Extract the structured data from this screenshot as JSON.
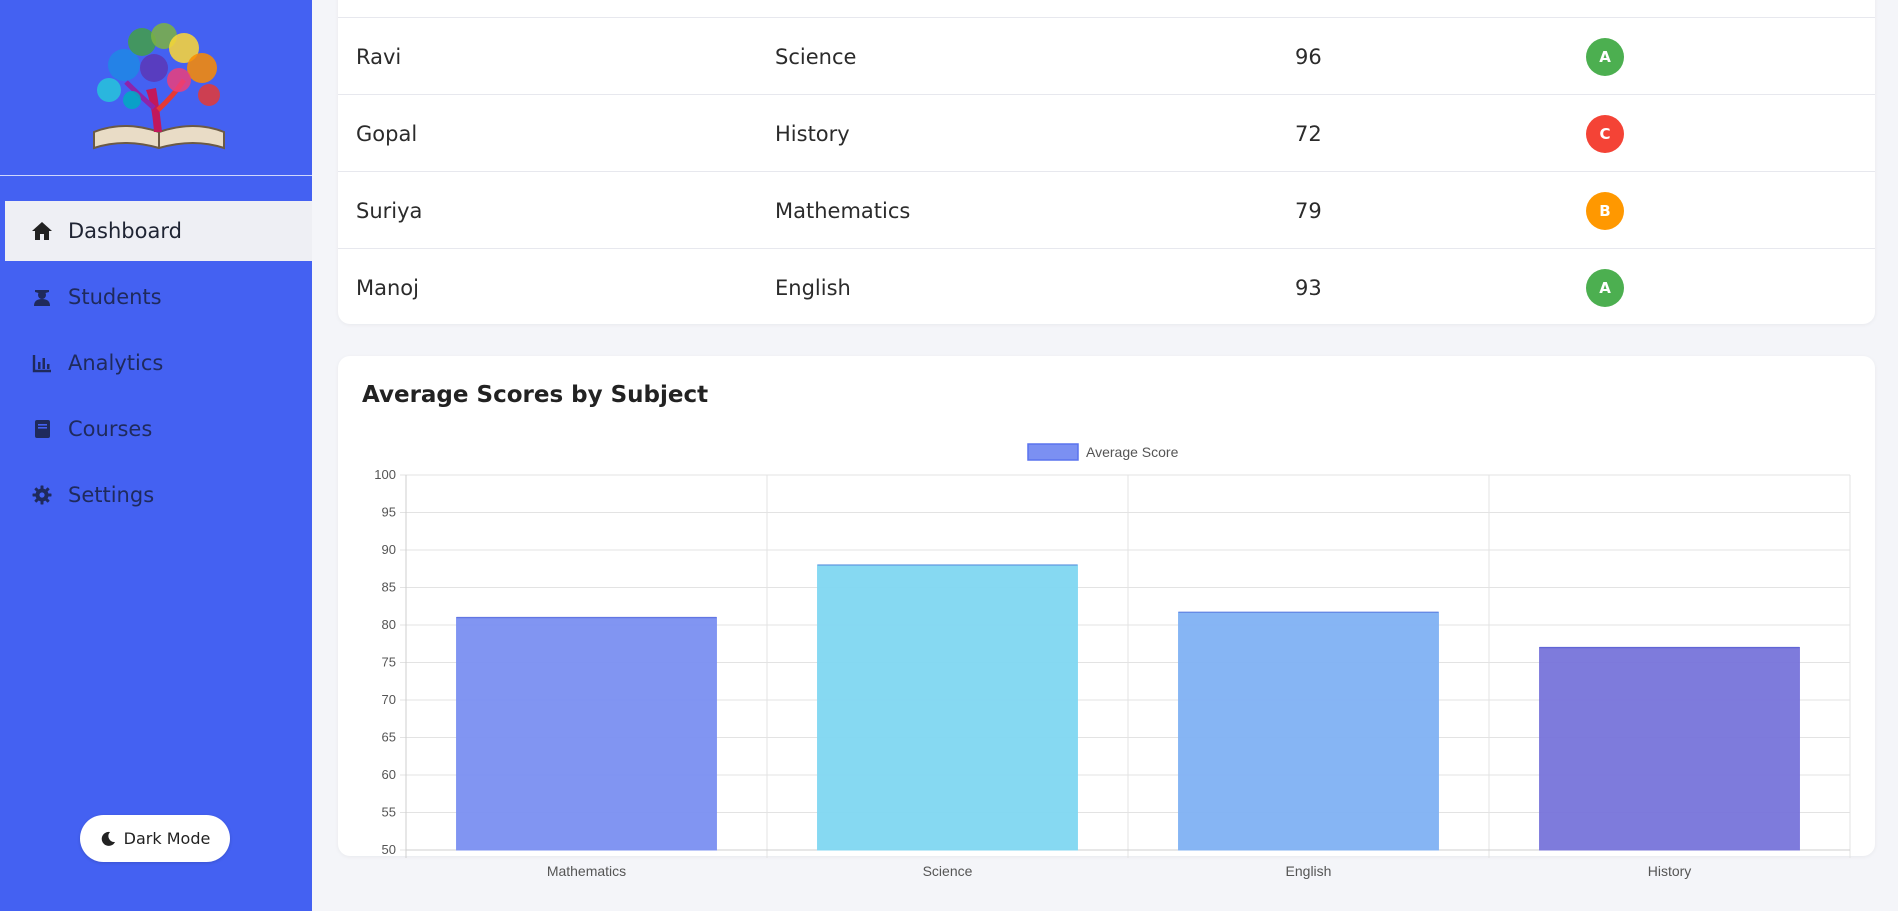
{
  "sidebar": {
    "logo_icon": "tree-book-logo",
    "items": [
      {
        "label": "Dashboard",
        "icon": "home-icon",
        "active": true
      },
      {
        "label": "Students",
        "icon": "student-icon",
        "active": false
      },
      {
        "label": "Analytics",
        "icon": "chart-icon",
        "active": false
      },
      {
        "label": "Courses",
        "icon": "book-icon",
        "active": false
      },
      {
        "label": "Settings",
        "icon": "gear-icon",
        "active": false
      }
    ],
    "dark_mode_label": "Dark Mode",
    "dark_mode_icon": "moon-icon"
  },
  "table": {
    "rows": [
      {
        "name": "Ravi",
        "subject": "Science",
        "score": "96",
        "grade": "A",
        "grade_color": "#4caf50"
      },
      {
        "name": "Gopal",
        "subject": "History",
        "score": "72",
        "grade": "C",
        "grade_color": "#f44336"
      },
      {
        "name": "Suriya",
        "subject": "Mathematics",
        "score": "79",
        "grade": "B",
        "grade_color": "#ff9800"
      },
      {
        "name": "Manoj",
        "subject": "English",
        "score": "93",
        "grade": "A",
        "grade_color": "#4caf50"
      }
    ]
  },
  "chart": {
    "title": "Average Scores by Subject"
  },
  "chart_data": {
    "type": "bar",
    "categories": [
      "Mathematics",
      "Science",
      "English",
      "History"
    ],
    "series": [
      {
        "name": "Average Score",
        "values": [
          81,
          88,
          81.7,
          77
        ]
      }
    ],
    "bar_colors": [
      "#7b90f2",
      "#80d8f2",
      "#80b2f4",
      "#7874db"
    ],
    "ylim": [
      50,
      100
    ],
    "yticks": [
      100,
      95,
      90,
      85,
      80,
      75,
      70,
      65,
      60,
      55,
      50
    ],
    "grid": true,
    "legend_position": "top-center"
  },
  "colors": {
    "sidebar_bg": "#4461f2",
    "active_item_bg": "#eeeff4",
    "page_bg": "#f4f5f9"
  }
}
